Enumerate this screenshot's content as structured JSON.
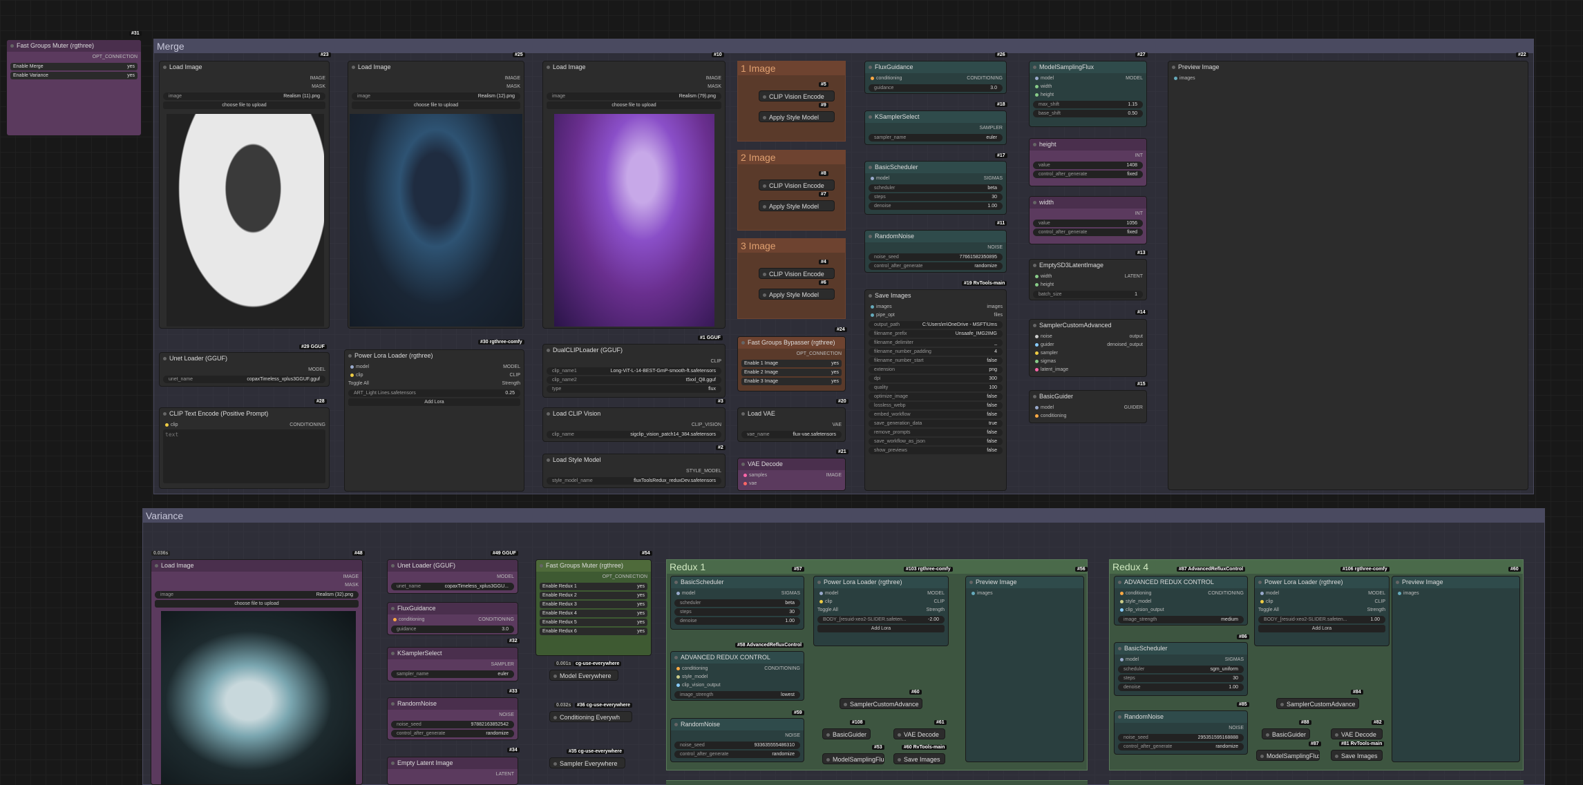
{
  "groups": {
    "merge": "Merge",
    "variance": "Variance"
  },
  "fgm": {
    "title": "Fast Groups Muter (rgthree)",
    "id": "#31",
    "out": "OPT_CONNECTION",
    "r1": "Enable Merge",
    "r2": "Enable Variance",
    "v": "yes"
  },
  "li1": {
    "title": "Load Image",
    "id": "#23",
    "image": "Realism (11).png"
  },
  "li2": {
    "title": "Load Image",
    "id": "#25",
    "image": "Realism (12).png"
  },
  "li3": {
    "title": "Load Image",
    "id": "#10",
    "image": "Realism (79).png"
  },
  "li_common": {
    "o1": "IMAGE",
    "o2": "MASK",
    "wimage": "image",
    "upload": "choose file to upload"
  },
  "unet": {
    "title": "Unet Loader (GGUF)",
    "id": "#29 GGUF",
    "out": "MODEL",
    "wname": "unet_name",
    "val": "copaxTimeless_xplus3GGUF.gguf"
  },
  "clipenc": {
    "title": "CLIP Text Encode (Positive Prompt)",
    "id": "#28",
    "in": "clip",
    "out": "CONDITIONING",
    "ph": "text"
  },
  "plora": {
    "title": "Power Lora Loader (rgthree)",
    "id": "#30 rgthree-comfy",
    "i1": "model",
    "i2": "clip",
    "o1": "MODEL",
    "o2": "CLIP",
    "toggle": "Toggle All",
    "strength": "Strength",
    "lora": "ART_Light Lines.safetensors",
    "lorav": "0.25",
    "add": "Add Lora"
  },
  "dclip": {
    "title": "DualCLIPLoader (GGUF)",
    "id": "#1 GGUF",
    "out": "CLIP",
    "w1": "clip_name1",
    "v1": "Long-ViT-L-14-BEST-GmP-smooth-ft.safetensors",
    "w2": "clip_name2",
    "v2": "t5xxl_Q8.gguf",
    "w3": "type",
    "v3": "flux"
  },
  "lclip": {
    "title": "Load CLIP Vision",
    "id": "#3",
    "out": "CLIP_VISION",
    "w": "clip_name",
    "v": "sigclip_vision_patch14_384.safetensors"
  },
  "lstyle": {
    "title": "Load Style Model",
    "id": "#2",
    "out": "STYLE_MODEL",
    "w": "style_model_name",
    "v": "fluxToolsRedux_reduxDev.safetensors"
  },
  "imgg": [
    {
      "t": "1 Image",
      "a": "#5",
      "b": "#9"
    },
    {
      "t": "2 Image",
      "a": "#8",
      "b": "#7"
    },
    {
      "t": "3 Image",
      "a": "#4",
      "b": "#6"
    }
  ],
  "imgg_common": {
    "cve": "CLIP Vision Encode",
    "asm": "Apply Style Model"
  },
  "fgb": {
    "title": "Fast Groups Bypasser (rgthree)",
    "id": "#24",
    "out": "OPT_CONNECTION",
    "r1": "Enable 1 Image",
    "r2": "Enable 2 Image",
    "r3": "Enable 3 Image",
    "v": "yes"
  },
  "lvae": {
    "title": "Load VAE",
    "id": "#20",
    "out": "VAE",
    "w": "vae_name",
    "v": "flux-vae.safetensors"
  },
  "vaed": {
    "title": "VAE Decode",
    "id": "#21",
    "i1": "samples",
    "i2": "vae",
    "out": "IMAGE"
  },
  "fluxg": {
    "title": "FluxGuidance",
    "id": "#26",
    "in": "conditioning",
    "out": "CONDITIONING",
    "w": "guidance",
    "v": "3.0"
  },
  "ksel": {
    "title": "KSamplerSelect",
    "id": "#18",
    "out": "SAMPLER",
    "w": "sampler_name",
    "v": "euler"
  },
  "bsched": {
    "title": "BasicScheduler",
    "id": "#17",
    "in": "model",
    "out": "SIGMAS",
    "w1": "scheduler",
    "v1": "beta",
    "w2": "steps",
    "v2": "30",
    "w3": "denoise",
    "v3": "1.00"
  },
  "rnoise": {
    "title": "RandomNoise",
    "id": "#11",
    "out": "NOISE",
    "w1": "noise_seed",
    "v1": "776615823508​95",
    "w2": "control_after_generate",
    "v2": "randomize"
  },
  "save": {
    "title": "Save Images",
    "id": "#19 RvTools-main",
    "i1": "images",
    "i2": "pipe_opt",
    "o1": "images",
    "o2": "files",
    "rows": [
      [
        "output_path",
        "C:\\Users\\m\\OneDrive - MSFT\\Ums"
      ],
      [
        "filename_prefix",
        "Unsaafe_IMG2IMG"
      ],
      [
        "filename_delimiter",
        "_"
      ],
      [
        "filename_number_padding",
        "4"
      ],
      [
        "filename_number_start",
        "false"
      ],
      [
        "extension",
        "png"
      ],
      [
        "dpi",
        "300"
      ],
      [
        "quality",
        "100"
      ],
      [
        "optimize_image",
        "false"
      ],
      [
        "lossless_webp",
        "false"
      ],
      [
        "embed_workflow",
        "false"
      ],
      [
        "save_generation_data",
        "true"
      ],
      [
        "remove_prompts",
        "false"
      ],
      [
        "save_workflow_as_json",
        "false"
      ],
      [
        "show_previews",
        "false"
      ]
    ]
  },
  "msf": {
    "title": "ModelSamplingFlux",
    "id": "#27",
    "i1": "model",
    "i2": "width",
    "i3": "height",
    "out": "MODEL",
    "w1": "max_shift",
    "v1": "1.15",
    "w2": "base_shift",
    "v2": "0.50"
  },
  "height": {
    "title": "height",
    "out": "INT",
    "w1": "value",
    "v1": "1408",
    "w2": "control_after_generate",
    "v2": "fixed"
  },
  "width": {
    "title": "width",
    "out": "INT",
    "w1": "value",
    "v1": "1056",
    "w2": "control_after_generate",
    "v2": "fixed"
  },
  "esd3": {
    "title": "EmptySD3LatentImage",
    "id": "#13",
    "i1": "width",
    "i2": "height",
    "out": "LATENT",
    "w": "batch_size",
    "v": "1"
  },
  "sca": {
    "title": "SamplerCustomAdvanced",
    "id": "#14",
    "i1": "noise",
    "i2": "guider",
    "i3": "sampler",
    "i4": "sigmas",
    "i5": "latent_image",
    "o1": "output",
    "o2": "denoised_output"
  },
  "bguide": {
    "title": "BasicGuider",
    "id": "#15",
    "i1": "model",
    "i2": "conditioning",
    "out": "GUIDER"
  },
  "prev": {
    "title": "Preview Image",
    "id": "#22",
    "in": "images"
  },
  "v_li": {
    "title": "Load Image",
    "id": "#48",
    "badge": "0.036s",
    "image": "Realism (32).png"
  },
  "v_unet": {
    "title": "Unet Loader (GGUF)",
    "id": "#49 GGUF",
    "out": "MODEL",
    "w": "unet_name",
    "v": "copaxTimeless_xplus3GGU..."
  },
  "v_flux": {
    "title": "FluxGuidance",
    "id": "#32",
    "in": "conditioning",
    "out": "CONDITIONING",
    "w": "guidance",
    "v": "3.0"
  },
  "v_ksel": {
    "title": "KSamplerSelect",
    "id": "#33",
    "out": "SAMPLER",
    "w": "sampler_name",
    "v": "euler"
  },
  "v_rn": {
    "title": "RandomNoise",
    "id": "#34",
    "out": "NOISE",
    "w1": "noise_seed",
    "v1": "978821638​52542",
    "w2": "control_after_generate",
    "v2": "randomize"
  },
  "v_eli": {
    "title": "Empty Latent Image",
    "out": "LATENT"
  },
  "v_fgm": {
    "title": "Fast Groups Muter (rgthree)",
    "id": "#54",
    "out": "OPT_CONNECTION",
    "rows": [
      "Enable Redux 1",
      "Enable Redux 2",
      "Enable Redux 3",
      "Enable Redux 4",
      "Enable Redux 5",
      "Enable Redux 6"
    ],
    "v": "yes"
  },
  "v_me": {
    "badge": "0.001s",
    "tag": "cg-use-everywhere",
    "label": "Model Everywhere"
  },
  "v_ce": {
    "badge": "0.032s",
    "tag": "#36 cg-use-everywhere",
    "label": "Conditioning Everywh"
  },
  "v_se": {
    "tag": "#35 cg-use-everywhere",
    "label": "Sampler Everywhere"
  },
  "r1": {
    "title": "Redux 1",
    "id": "#56",
    "bs": {
      "title": "BasicScheduler",
      "id": "#57",
      "in": "model",
      "out": "SIGMAS",
      "v1": "beta",
      "v2": "30",
      "v3": "1.00"
    },
    "arc": {
      "title": "ADVANCED REDUX CONTROL",
      "id": "#58 AdvancedRefluxControl",
      "i1": "conditioning",
      "i2": "style_model",
      "i3": "clip_vision_output",
      "out": "CONDITIONING",
      "w": "image_strength",
      "v": "lowest"
    },
    "rn": {
      "title": "RandomNoise",
      "id": "#59",
      "out": "NOISE",
      "v1": "933635555486310",
      "v2": "randomize"
    },
    "pl": {
      "title": "Power Lora Loader (rgthree)",
      "id": "#103 rgthree-comfy",
      "lora": "BODY_[resuid-xeo2-SLIDER.safeten...",
      "lorav": "-2.00"
    },
    "pv": {
      "title": "Preview Image"
    },
    "sca": "SamplerCustomAdvance",
    "sca_id": "#60",
    "bg": "BasicGuider",
    "bg_id": "#108",
    "vd": "VAE Decode",
    "vd_id": "#61",
    "msf": "ModelSamplingFlux",
    "msf_id": "#53",
    "si": "Save Images",
    "si_id": "#60 RvTools-main"
  },
  "r4": {
    "title": "Redux 4",
    "id": "#60",
    "arc": {
      "title": "ADVANCED REDUX CONTROL",
      "id": "#87 AdvancedRefluxControl",
      "v": "medium"
    },
    "bs": {
      "title": "BasicScheduler",
      "id": "#86",
      "v1": "sgm_uniform",
      "v2": "30",
      "v3": "1.00"
    },
    "rn": {
      "title": "RandomNoise",
      "id": "#85",
      "v1": "295351595168888",
      "v2": "randomize"
    },
    "pl": {
      "title": "Power Lora Loader (rgthree)",
      "id": "#106 rgthree-comfy",
      "lora": "BODY_[resuid-xeo2-SLIDER.safeten...",
      "lorav": "1.00"
    },
    "pv": {
      "title": "Preview Image"
    },
    "sca": "SamplerCustomAdvance",
    "sca_id": "#84",
    "bg": "BasicGuider",
    "bg_id": "#88",
    "vd": "VAE Decode",
    "vd_id": "#82",
    "msf": "ModelSamplingFlux",
    "msf_id": "#87",
    "si": "Save Images",
    "si_id": "#81 RvTools-main"
  },
  "w_common": {
    "scheduler": "scheduler",
    "steps": "steps",
    "denoise": "denoise",
    "noise_seed": "noise_seed",
    "cag": "control_after_generate",
    "model": "model",
    "clip": "clip",
    "images": "images"
  }
}
